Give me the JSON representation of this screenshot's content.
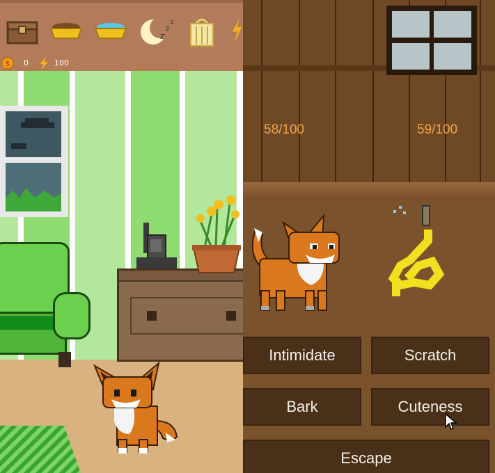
{
  "toolbar": {
    "items": [
      {
        "icon": "chest-icon"
      },
      {
        "icon": "food-bowl-icon"
      },
      {
        "icon": "water-bowl-icon"
      },
      {
        "icon": "sleep-moon-icon"
      },
      {
        "icon": "bag-icon"
      },
      {
        "icon": "lightning-icon"
      }
    ]
  },
  "status": {
    "coins": "0",
    "energy": "100",
    "coin_icon": "coin-icon",
    "energy_icon": "lightning-icon"
  },
  "battle": {
    "player_hp": "58/100",
    "enemy_hp": "59/100",
    "player_hp_fraction": 0.58,
    "enemy_hp_fraction": 0.59
  },
  "actions": {
    "intimidate": "Intimidate",
    "scratch": "Scratch",
    "bark": "Bark",
    "cuteness": "Cuteness",
    "escape": "Escape"
  },
  "colors": {
    "hp_text": "#f0a24a",
    "button_bg": "#4a3018",
    "wall_green": "#8fdc72",
    "toolbar": "#b27c5c"
  }
}
